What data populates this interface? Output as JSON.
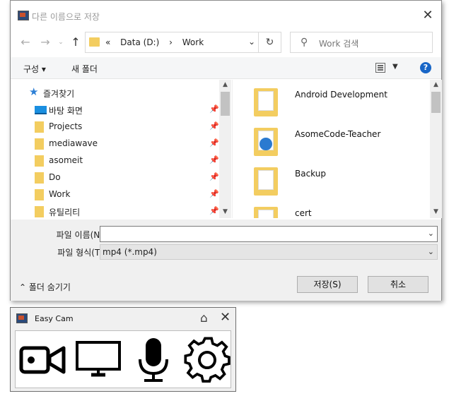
{
  "save_dialog": {
    "title": "다른 이름으로 저장",
    "address": {
      "crumbs": [
        "«",
        "Data (D:)",
        "›",
        "Work"
      ]
    },
    "search": {
      "placeholder": "Work 검색"
    },
    "toolbar": {
      "organize": "구성 ▾",
      "new_folder": "새 폴더"
    },
    "nav_pane": {
      "favorites": "즐겨찾기",
      "items": [
        {
          "label": "바탕 화면",
          "icon": "desktop-icon"
        },
        {
          "label": "Projects",
          "icon": "folder-icon"
        },
        {
          "label": "mediawave",
          "icon": "folder-icon"
        },
        {
          "label": "asomeit",
          "icon": "folder-icon"
        },
        {
          "label": "Do",
          "icon": "folder-icon"
        },
        {
          "label": "Work",
          "icon": "folder-icon"
        },
        {
          "label": "유틸리티",
          "icon": "folder-icon"
        }
      ]
    },
    "files": [
      {
        "name": "Android Development",
        "icon": "folder-icon"
      },
      {
        "name": "AsomeCode-Teacher",
        "icon": "folder-app-icon"
      },
      {
        "name": "Backup",
        "icon": "folder-icon"
      },
      {
        "name": "cert",
        "icon": "folder-icon"
      }
    ],
    "file_name_label": "파일 이름(N):",
    "file_name_value": "",
    "file_type_label": "파일 형식(T):",
    "file_type_value": "mp4 (*.mp4)",
    "hide_folders": "폴더 숨기기",
    "save_button": "저장(S)",
    "cancel_button": "취소"
  },
  "easy_cam": {
    "title": "Easy Cam",
    "buttons": [
      "camera-icon",
      "monitor-icon",
      "microphone-icon",
      "settings-gear-icon"
    ]
  }
}
